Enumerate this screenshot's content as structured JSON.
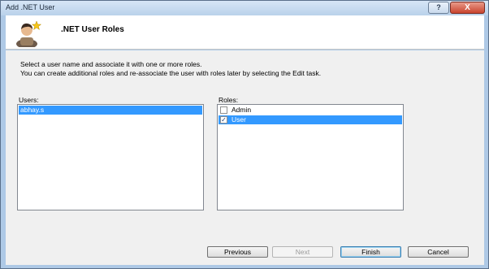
{
  "window": {
    "title": "Add .NET User",
    "help_label": "?",
    "close_label": "X"
  },
  "header": {
    "title": ".NET User Roles"
  },
  "instructions": {
    "line1": "Select a user name and associate it with one or more roles.",
    "line2": "You can create additional roles and re-associate the user with roles later by selecting the Edit task."
  },
  "users": {
    "label": "Users:",
    "items": [
      "abhay.s"
    ],
    "selected": "abhay.s"
  },
  "roles": {
    "label": "Roles:",
    "items": [
      {
        "name": "Admin",
        "checked": false,
        "selected": false
      },
      {
        "name": "User",
        "checked": true,
        "selected": true
      }
    ]
  },
  "buttons": {
    "previous": "Previous",
    "next": "Next",
    "finish": "Finish",
    "cancel": "Cancel"
  },
  "colors": {
    "selection": "#3399ff",
    "titlebar": "#b9d1ea",
    "close": "#c9442e"
  },
  "icons": {
    "header": "user-star-icon",
    "checkbox_checked": "checkmark-icon"
  }
}
